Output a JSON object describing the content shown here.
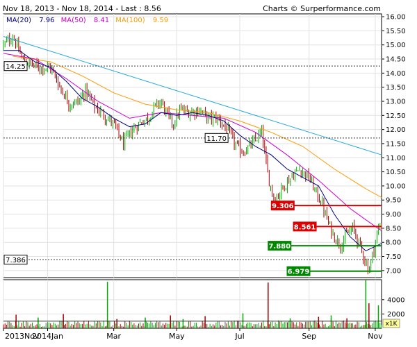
{
  "header": {
    "date_range": "Nov 18, 2013 - Nov 18, 2014 - Last : 8.56",
    "credit": "Charts © Surperformance.com"
  },
  "legend": [
    {
      "label": "MA(20)",
      "value": "7.96",
      "color": "#000080"
    },
    {
      "label": "MA(50)",
      "value": "8.41",
      "color": "#cc00cc"
    },
    {
      "label": "MA(100)",
      "value": "9.59",
      "color": "#ff9900"
    }
  ],
  "colors": {
    "up": "#00aa00",
    "down": "#aa0000",
    "trendline": "#22aadd",
    "resistance": "#dd0000",
    "support": "#008800",
    "dotted": "#333333",
    "volume_avg": "#222222",
    "volume_neutral": "#666666"
  },
  "chart_data": [
    {
      "type": "candlestick",
      "ylim": [
        6.75,
        16.1
      ],
      "y_ticks": [
        "7.00",
        "7.50",
        "8.00",
        "8.50",
        "9.00",
        "9.50",
        "10.00",
        "10.50",
        "11.00",
        "11.50",
        "12.00",
        "12.50",
        "13.00",
        "13.50",
        "14.00",
        "14.50",
        "15.00",
        "15.50",
        "16.00"
      ],
      "x_tick_labels": [
        "2013Nov",
        "2014Jan",
        "Mar",
        "May",
        "Jul",
        "Sep",
        "Nov"
      ],
      "x_ticks": [
        0.0,
        1.4,
        3.5,
        5.5,
        7.5,
        9.7,
        11.8
      ],
      "x_range": [
        0,
        12.0
      ],
      "price_path": [
        [
          0.0,
          15.0
        ],
        [
          0.3,
          15.3
        ],
        [
          0.6,
          14.5
        ],
        [
          0.9,
          14.3
        ],
        [
          1.2,
          14.2
        ],
        [
          1.5,
          14.2
        ],
        [
          1.8,
          13.5
        ],
        [
          2.1,
          12.9
        ],
        [
          2.4,
          13.0
        ],
        [
          2.6,
          13.4
        ],
        [
          2.9,
          12.8
        ],
        [
          3.2,
          12.5
        ],
        [
          3.5,
          12.2
        ],
        [
          3.8,
          11.5
        ],
        [
          4.1,
          12.0
        ],
        [
          4.4,
          12.3
        ],
        [
          4.6,
          12.4
        ],
        [
          4.8,
          12.8
        ],
        [
          5.0,
          13.0
        ],
        [
          5.2,
          12.5
        ],
        [
          5.4,
          12.2
        ],
        [
          5.6,
          12.7
        ],
        [
          5.9,
          12.6
        ],
        [
          6.2,
          12.7
        ],
        [
          6.5,
          12.4
        ],
        [
          6.8,
          12.4
        ],
        [
          7.1,
          12.0
        ],
        [
          7.4,
          11.4
        ],
        [
          7.6,
          11.2
        ],
        [
          7.9,
          11.5
        ],
        [
          8.2,
          11.9
        ],
        [
          8.4,
          10.3
        ],
        [
          8.6,
          9.5
        ],
        [
          8.9,
          10.0
        ],
        [
          9.2,
          10.4
        ],
        [
          9.4,
          10.6
        ],
        [
          9.7,
          10.3
        ],
        [
          9.9,
          9.8
        ],
        [
          10.1,
          9.4
        ],
        [
          10.3,
          8.7
        ],
        [
          10.5,
          8.2
        ],
        [
          10.7,
          7.9
        ],
        [
          10.9,
          8.3
        ],
        [
          11.1,
          8.5
        ],
        [
          11.3,
          7.9
        ],
        [
          11.5,
          7.3
        ],
        [
          11.6,
          7.0
        ],
        [
          11.8,
          8.0
        ],
        [
          11.9,
          8.5
        ],
        [
          12.0,
          8.56
        ]
      ],
      "ma20": [
        [
          0.0,
          14.8
        ],
        [
          0.5,
          14.8
        ],
        [
          1.0,
          14.4
        ],
        [
          1.5,
          14.2
        ],
        [
          2.0,
          13.7
        ],
        [
          2.5,
          13.1
        ],
        [
          3.0,
          12.8
        ],
        [
          3.5,
          12.4
        ],
        [
          4.0,
          12.1
        ],
        [
          4.5,
          12.2
        ],
        [
          5.0,
          12.6
        ],
        [
          5.5,
          12.5
        ],
        [
          6.0,
          12.6
        ],
        [
          6.5,
          12.5
        ],
        [
          7.0,
          12.3
        ],
        [
          7.5,
          11.8
        ],
        [
          8.0,
          11.4
        ],
        [
          8.5,
          11.1
        ],
        [
          9.0,
          10.6
        ],
        [
          9.5,
          10.3
        ],
        [
          10.0,
          10.0
        ],
        [
          10.5,
          9.0
        ],
        [
          11.0,
          8.2
        ],
        [
          11.5,
          7.7
        ],
        [
          12.0,
          7.96
        ]
      ],
      "ma50": [
        [
          0.0,
          14.7
        ],
        [
          1.0,
          14.5
        ],
        [
          2.0,
          13.8
        ],
        [
          3.0,
          13.0
        ],
        [
          4.0,
          12.4
        ],
        [
          5.0,
          12.6
        ],
        [
          6.0,
          12.5
        ],
        [
          7.0,
          12.4
        ],
        [
          8.0,
          11.9
        ],
        [
          9.0,
          11.1
        ],
        [
          10.0,
          10.2
        ],
        [
          11.0,
          9.2
        ],
        [
          11.5,
          8.8
        ],
        [
          12.0,
          8.41
        ]
      ],
      "ma100": [
        [
          0.3,
          14.6
        ],
        [
          1.5,
          14.4
        ],
        [
          2.5,
          13.9
        ],
        [
          3.5,
          13.3
        ],
        [
          4.5,
          12.9
        ],
        [
          5.5,
          12.7
        ],
        [
          6.5,
          12.6
        ],
        [
          7.5,
          12.3
        ],
        [
          8.5,
          11.9
        ],
        [
          9.5,
          11.4
        ],
        [
          10.5,
          10.6
        ],
        [
          11.5,
          9.9
        ],
        [
          12.0,
          9.59
        ]
      ],
      "trendline": [
        [
          0.0,
          15.3
        ],
        [
          12.0,
          11.1
        ]
      ],
      "levels": [
        {
          "value": 14.25,
          "label": "14.25",
          "style": "dotted",
          "label_at": "left"
        },
        {
          "value": 11.7,
          "label": "11.70",
          "style": "dotted",
          "label_at": "mid"
        },
        {
          "value": 9.306,
          "label": "9.306",
          "style": "resistance",
          "label_at": "right"
        },
        {
          "value": 8.561,
          "label": "8.561",
          "style": "resistance",
          "label_at": "right"
        },
        {
          "value": 7.88,
          "label": "7.880",
          "style": "support",
          "label_at": "right"
        },
        {
          "value": 7.386,
          "label": "7.386",
          "style": "dotted",
          "label_at": "left"
        },
        {
          "value": 6.979,
          "label": "6.979",
          "style": "support",
          "label_at": "right"
        }
      ]
    },
    {
      "type": "bar",
      "ylim": [
        0,
        6800
      ],
      "y_ticks": [
        "2000",
        "4000"
      ],
      "unit_label": "x1K",
      "avg_volume": 1000,
      "spikes": [
        [
          0.4,
          1900
        ],
        [
          1.1,
          1500
        ],
        [
          1.9,
          2000
        ],
        [
          3.3,
          6500
        ],
        [
          3.6,
          1300
        ],
        [
          4.5,
          1500
        ],
        [
          5.3,
          1800
        ],
        [
          5.7,
          1300
        ],
        [
          6.4,
          1700
        ],
        [
          7.6,
          2100
        ],
        [
          8.4,
          6400
        ],
        [
          9.1,
          1400
        ],
        [
          10.0,
          1600
        ],
        [
          10.4,
          1800
        ],
        [
          10.9,
          1400
        ],
        [
          11.5,
          6800
        ],
        [
          11.6,
          3500
        ],
        [
          11.9,
          3200
        ]
      ]
    }
  ]
}
